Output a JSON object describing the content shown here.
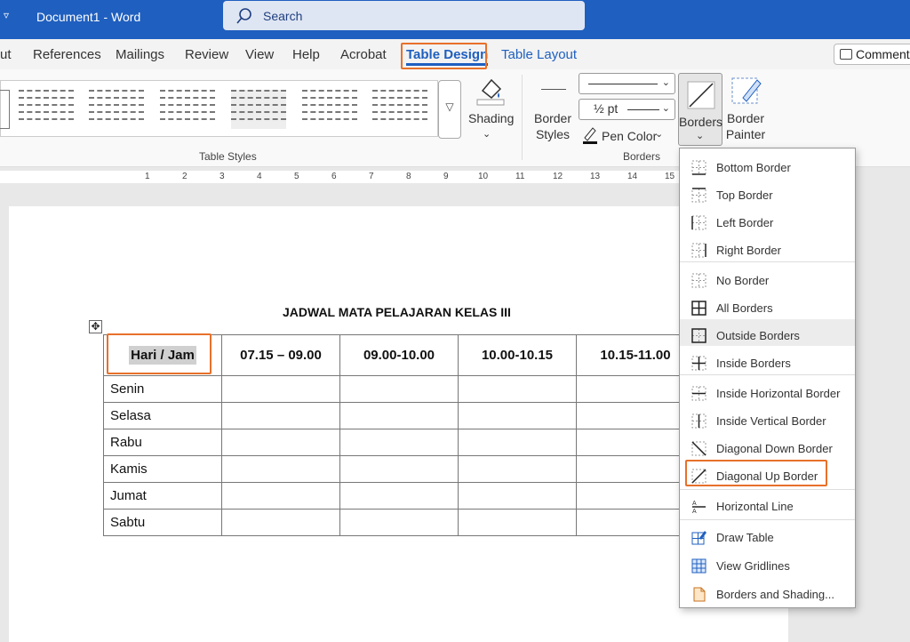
{
  "titlebar": {
    "app_title": "Document1  -  Word",
    "search_placeholder": "Search"
  },
  "tabs": [
    {
      "label": "ut"
    },
    {
      "label": "References"
    },
    {
      "label": "Mailings"
    },
    {
      "label": "Review"
    },
    {
      "label": "View"
    },
    {
      "label": "Help"
    },
    {
      "label": "Acrobat"
    },
    {
      "label": "Table Design"
    },
    {
      "label": "Table Layout"
    }
  ],
  "comments_label": "Comment",
  "ribbon": {
    "table_styles_label": "Table Styles",
    "shading_label": "Shading",
    "border_styles_label": "Border Styles",
    "line_weight": "½ pt",
    "pen_color_label": "Pen Color",
    "borders_label": "Borders",
    "border_painter_label": "Border Painter",
    "borders_group_label": "Borders"
  },
  "ruler_numbers": [
    "1",
    "2",
    "3",
    "4",
    "5",
    "6",
    "7",
    "8",
    "9",
    "10",
    "11",
    "12",
    "13",
    "14",
    "15"
  ],
  "document": {
    "title": "JADWAL MATA PELAJARAN KELAS III",
    "headers": [
      "Hari / Jam",
      "07.15 – 09.00",
      "09.00-10.00",
      "10.00-10.15",
      "10.15-11.00"
    ],
    "days": [
      "Senin",
      "Selasa",
      "Rabu",
      "Kamis",
      "Jumat",
      "Sabtu"
    ]
  },
  "borders_menu": [
    {
      "label": "Bottom Border"
    },
    {
      "label": "Top Border"
    },
    {
      "label": "Left Border"
    },
    {
      "label": "Right Border"
    },
    {
      "label": "No Border"
    },
    {
      "label": "All Borders"
    },
    {
      "label": "Outside Borders"
    },
    {
      "label": "Inside Borders"
    },
    {
      "label": "Inside Horizontal Border"
    },
    {
      "label": "Inside Vertical Border"
    },
    {
      "label": "Diagonal Down Border"
    },
    {
      "label": "Diagonal Up Border"
    },
    {
      "label": "Horizontal Line"
    },
    {
      "label": "Draw Table"
    },
    {
      "label": "View Gridlines"
    },
    {
      "label": "Borders and Shading..."
    }
  ],
  "colors": {
    "accent": "#1f5fbf",
    "highlight_box": "#e8702a"
  }
}
